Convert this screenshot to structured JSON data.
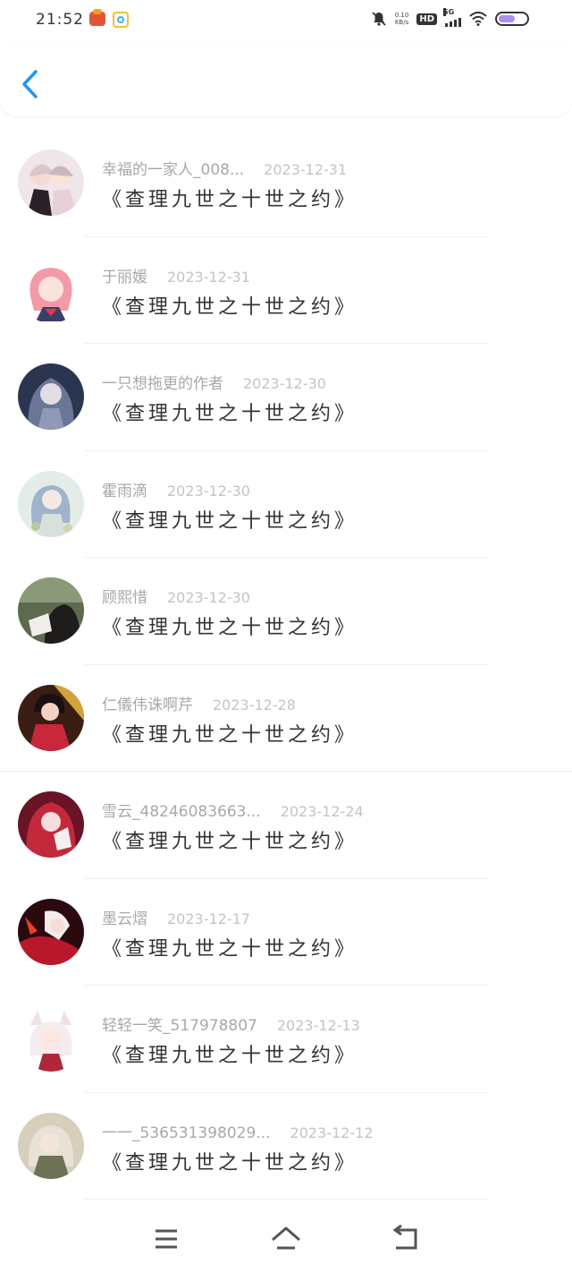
{
  "status": {
    "time": "21:52",
    "net_speed_value": "0.10",
    "net_speed_unit": "KB/s",
    "hd": "HD",
    "network": "5G"
  },
  "comments": [
    {
      "name": "幸福的一家人_008...",
      "date": "2023-12-31",
      "text": "《查理九世之十世之约》"
    },
    {
      "name": "于丽媛",
      "date": "2023-12-31",
      "text": "《查理九世之十世之约》"
    },
    {
      "name": "一只想拖更的作者",
      "date": "2023-12-30",
      "text": "《查理九世之十世之约》"
    },
    {
      "name": "霍雨滴",
      "date": "2023-12-30",
      "text": "《查理九世之十世之约》"
    },
    {
      "name": "顾熙惜",
      "date": "2023-12-30",
      "text": "《查理九世之十世之约》"
    },
    {
      "name": "仁儀伟诛啊芹",
      "date": "2023-12-28",
      "text": "《查理九世之十世之约》"
    },
    {
      "name": "雪云_48246083663...",
      "date": "2023-12-24",
      "text": "《查理九世之十世之约》"
    },
    {
      "name": "墨云熠",
      "date": "2023-12-17",
      "text": "《查理九世之十世之约》"
    },
    {
      "name": "轻轻一笑_517978807",
      "date": "2023-12-13",
      "text": "《查理九世之十世之约》"
    },
    {
      "name": "一一_536531398029...",
      "date": "2023-12-12",
      "text": "《查理九世之十世之约》"
    }
  ],
  "colors": {
    "accent": "#2196f3",
    "name_text": "#a8a8a8",
    "date_text": "#c4c4c4",
    "comment_text": "#333333"
  }
}
